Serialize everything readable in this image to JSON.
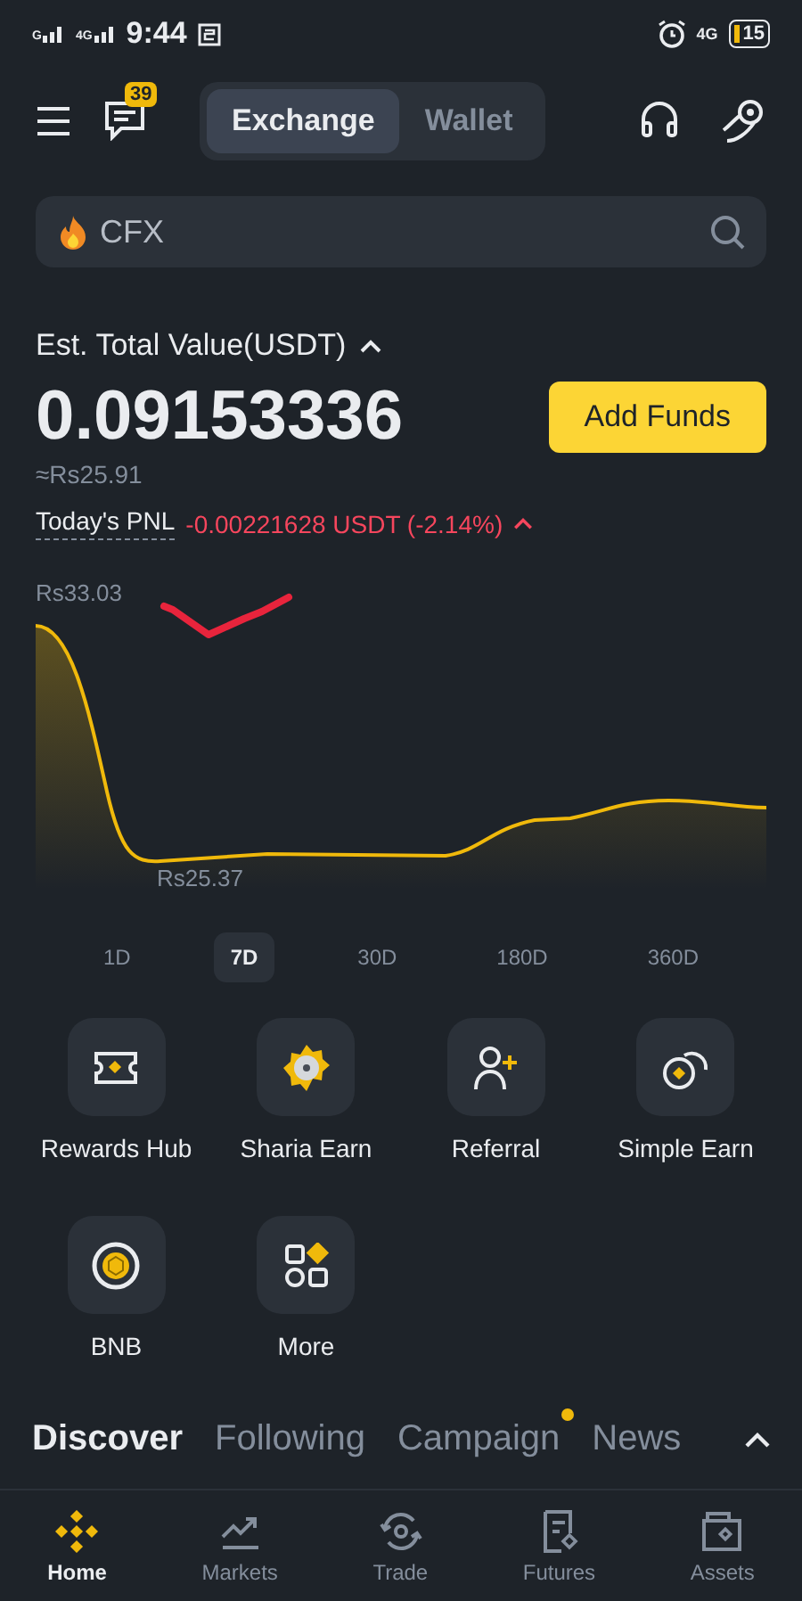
{
  "status_bar": {
    "networks": [
      "G",
      "4G"
    ],
    "time": "9:44",
    "network_right": "4G",
    "battery": "15"
  },
  "header": {
    "badge": "39",
    "segments": [
      {
        "label": "Exchange",
        "selected": true
      },
      {
        "label": "Wallet",
        "selected": false
      }
    ]
  },
  "search": {
    "placeholder": "CFX"
  },
  "balance": {
    "title": "Est. Total Value(USDT)",
    "value": "0.09153336",
    "fiat": "≈Rs25.91",
    "button": "Add Funds",
    "pnl_label": "Today's PNL",
    "pnl_value": "-0.00221628 USDT (-2.14%)"
  },
  "chart": {
    "max_label": "Rs33.03",
    "min_label": "Rs25.37"
  },
  "ranges": [
    {
      "label": "1D",
      "selected": false
    },
    {
      "label": "7D",
      "selected": true
    },
    {
      "label": "30D",
      "selected": false
    },
    {
      "label": "180D",
      "selected": false
    },
    {
      "label": "360D",
      "selected": false
    }
  ],
  "shortcuts": [
    {
      "kind": "ticket",
      "label": "Rewards Hub"
    },
    {
      "kind": "badge",
      "label": "Sharia Earn"
    },
    {
      "kind": "person",
      "label": "Referral"
    },
    {
      "kind": "coins",
      "label": "Simple Earn"
    },
    {
      "kind": "cube",
      "label": "BNB"
    },
    {
      "kind": "grid",
      "label": "More"
    }
  ],
  "feed_tabs": [
    {
      "label": "Discover",
      "selected": true,
      "dot": false
    },
    {
      "label": "Following",
      "selected": false,
      "dot": false
    },
    {
      "label": "Campaign",
      "selected": false,
      "dot": true
    },
    {
      "label": "News",
      "selected": false,
      "dot": false
    }
  ],
  "nav": [
    {
      "kind": "home",
      "label": "Home",
      "selected": true
    },
    {
      "kind": "markets",
      "label": "Markets",
      "selected": false
    },
    {
      "kind": "trade",
      "label": "Trade",
      "selected": false
    },
    {
      "kind": "futures",
      "label": "Futures",
      "selected": false
    },
    {
      "kind": "assets",
      "label": "Assets",
      "selected": false
    }
  ]
}
